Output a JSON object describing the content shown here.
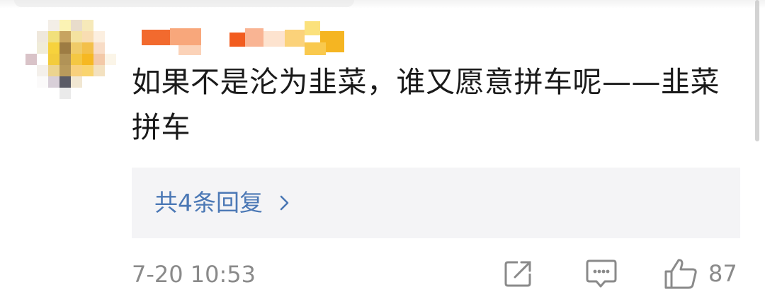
{
  "comment": {
    "text": "如果不是沦为韭菜，谁又愿意拼车呢——韭菜拼车",
    "replies_label": "共4条回复",
    "timestamp": "7-20 10:53",
    "like_count": "87"
  },
  "icons": {
    "share": "share-icon",
    "reply": "reply-icon",
    "like": "thumbs-up-icon",
    "chevron": "chevron-right-icon"
  },
  "colors": {
    "link": "#4b78b5",
    "reply_box_bg": "#f4f4f6",
    "meta_text": "#8a8a8a",
    "body_text": "#1a1a1a"
  }
}
